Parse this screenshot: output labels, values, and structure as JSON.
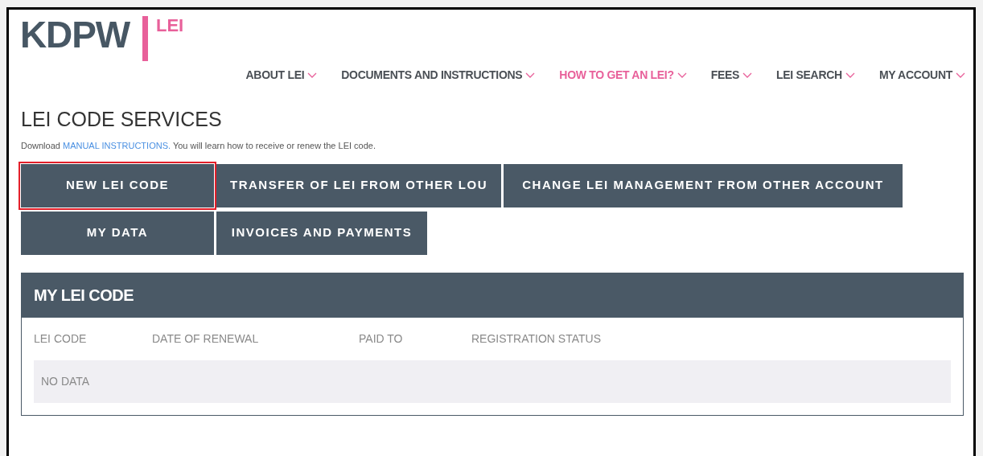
{
  "logo": {
    "brand": "KDPW",
    "product": "LEI"
  },
  "nav": [
    {
      "label": "ABOUT LEI",
      "selected": false
    },
    {
      "label": "DOCUMENTS AND INSTRUCTIONS",
      "selected": false
    },
    {
      "label": "HOW TO GET AN LEI?",
      "selected": true
    },
    {
      "label": "FEES",
      "selected": false
    },
    {
      "label": "LEI SEARCH",
      "selected": false
    },
    {
      "label": "MY ACCOUNT",
      "selected": false
    }
  ],
  "page_title": "LEI CODE SERVICES",
  "intro": {
    "before": "Download",
    "link": "MANUAL INSTRUCTIONS.",
    "after": "You will learn how to receive or renew the LEI code."
  },
  "service_buttons": [
    [
      {
        "label": "NEW LEI CODE",
        "highlighted": true
      },
      {
        "label": "TRANSFER OF LEI FROM OTHER LOU",
        "highlighted": false
      },
      {
        "label": "CHANGE LEI MANAGEMENT FROM OTHER ACCOUNT",
        "highlighted": false
      }
    ],
    [
      {
        "label": "MY DATA",
        "highlighted": false
      },
      {
        "label": "INVOICES AND PAYMENTS",
        "highlighted": false
      }
    ]
  ],
  "panel": {
    "title": "MY LEI CODE",
    "columns": [
      "LEI CODE",
      "DATE OF RENEWAL",
      "PAID TO",
      "REGISTRATION STATUS"
    ],
    "empty_text": "NO DATA"
  }
}
